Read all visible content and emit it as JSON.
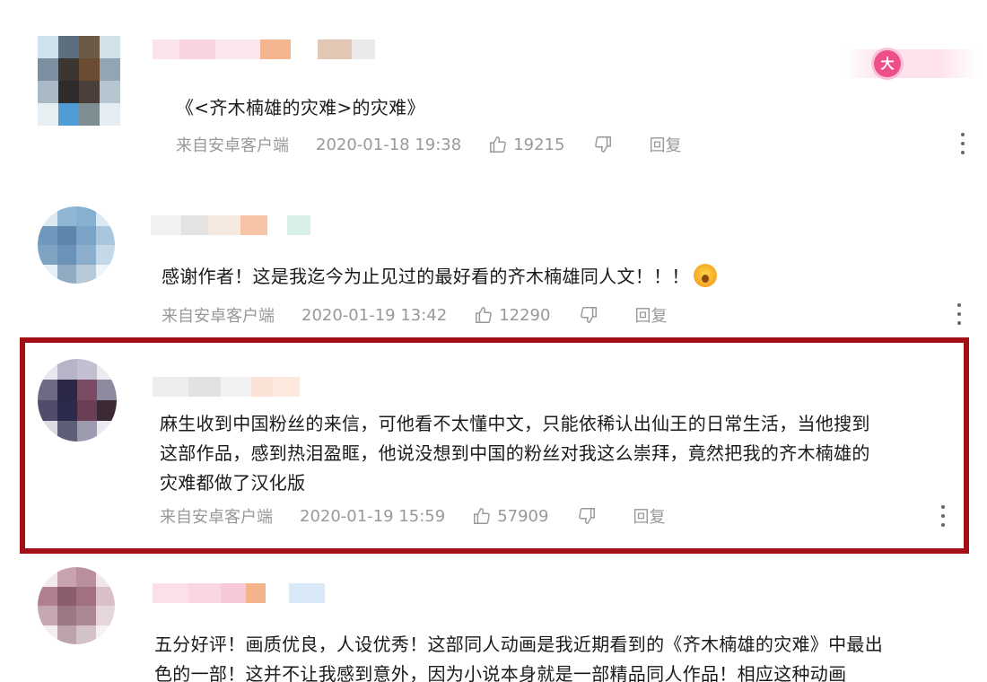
{
  "comments": [
    {
      "text": "《<齐木楠雄的灾难>的灾难》",
      "source": "来自安卓客户端",
      "time": "2020-01-18 19:38",
      "likes": "19215",
      "reply_label": "回复",
      "badge": "大"
    },
    {
      "text": "感谢作者！这是我迄今为止见过的最好看的齐木楠雄同人文！！！",
      "source": "来自安卓客户端",
      "time": "2020-01-19 13:42",
      "likes": "12290",
      "reply_label": "回复"
    },
    {
      "text_lines": [
        "麻生收到中国粉丝的来信，可他看不太懂中文，只能依稀认出仙王的日常生活，当他搜到",
        "这部作品，感到热泪盈眶，他说没想到中国的粉丝对我这么崇拜，竟然把我的齐木楠雄的",
        "灾难都做了汉化版"
      ],
      "source": "来自安卓客户端",
      "time": "2020-01-19 15:59",
      "likes": "57909",
      "reply_label": "回复"
    },
    {
      "text_lines": [
        "五分好评！画质优良，人设优秀！这部同人动画是我近期看到的《齐木楠雄的灾难》中最出",
        "色的一部！这并不让我感到意外，因为小说本身就是一部精品同人作品！相应这种动画"
      ]
    }
  ],
  "icons": [
    "thumbs-up-icon",
    "thumbs-down-icon",
    "more-icon",
    "emoji-icon"
  ],
  "colors": {
    "highlight": "#a30f16",
    "meta_text": "#999999",
    "badge": "#ee4f8a"
  }
}
